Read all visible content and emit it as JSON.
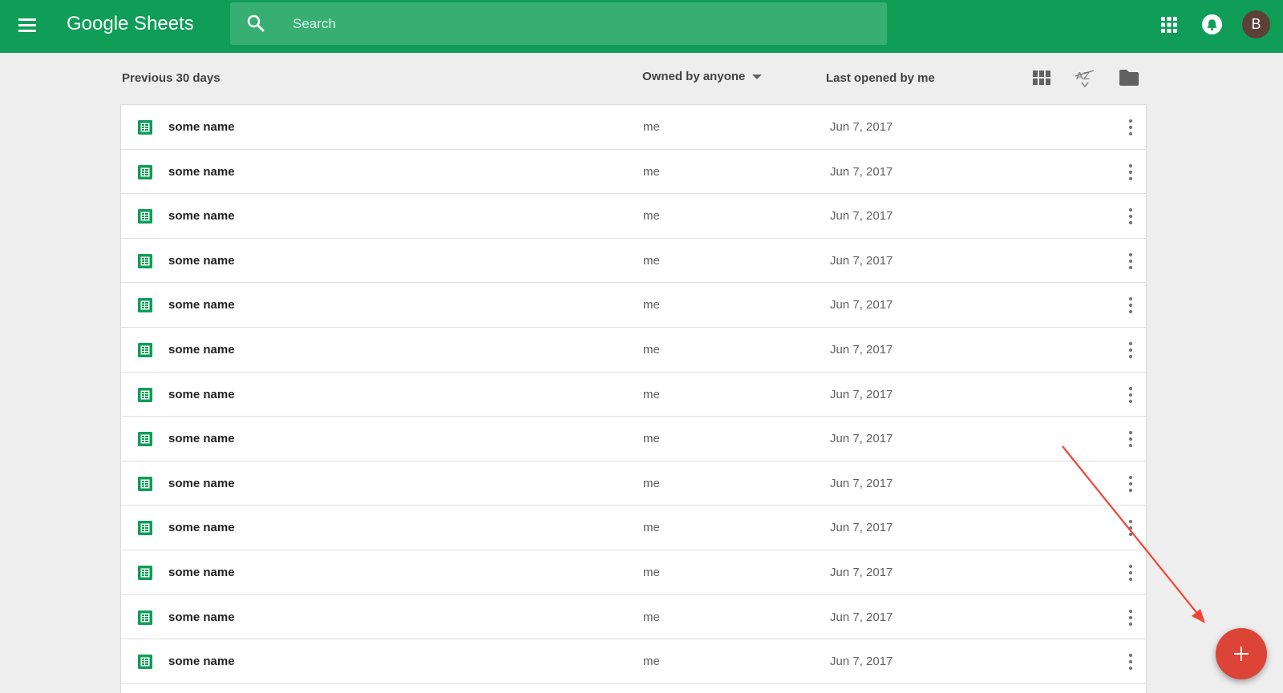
{
  "app": {
    "title": "Google Sheets"
  },
  "search": {
    "placeholder": "Search"
  },
  "account": {
    "initial": "B"
  },
  "list_header": {
    "period": "Previous 30 days",
    "owner_filter": "Owned by anyone",
    "sort_column": "Last opened by me"
  },
  "files": [
    {
      "name": "some name",
      "owner": "me",
      "date": "Jun 7, 2017"
    },
    {
      "name": "some name",
      "owner": "me",
      "date": "Jun 7, 2017"
    },
    {
      "name": "some name",
      "owner": "me",
      "date": "Jun 7, 2017"
    },
    {
      "name": "some name",
      "owner": "me",
      "date": "Jun 7, 2017"
    },
    {
      "name": "some name",
      "owner": "me",
      "date": "Jun 7, 2017"
    },
    {
      "name": "some name",
      "owner": "me",
      "date": "Jun 7, 2017"
    },
    {
      "name": "some name",
      "owner": "me",
      "date": "Jun 7, 2017"
    },
    {
      "name": "some name",
      "owner": "me",
      "date": "Jun 7, 2017"
    },
    {
      "name": "some name",
      "owner": "me",
      "date": "Jun 7, 2017"
    },
    {
      "name": "some name",
      "owner": "me",
      "date": "Jun 7, 2017"
    },
    {
      "name": "some name",
      "owner": "me",
      "date": "Jun 7, 2017"
    },
    {
      "name": "some name",
      "owner": "me",
      "date": "Jun 7, 2017"
    },
    {
      "name": "some name",
      "owner": "me",
      "date": "Jun 7, 2017"
    }
  ],
  "icons": {
    "menu": "hamburger-icon",
    "search": "search-icon",
    "apps": "apps-grid-icon",
    "notifications": "bell-icon",
    "grid_view": "grid-view-icon",
    "sort": "sort-az-icon",
    "folder": "folder-icon",
    "file": "sheets-file-icon",
    "more": "more-vert-icon",
    "create": "plus-icon"
  },
  "colors": {
    "brand": "#0f9d58",
    "search_bg": "#37af73",
    "fab": "#db4437",
    "annotation_arrow": "#f44336",
    "file_icon": "#0f9d58"
  }
}
